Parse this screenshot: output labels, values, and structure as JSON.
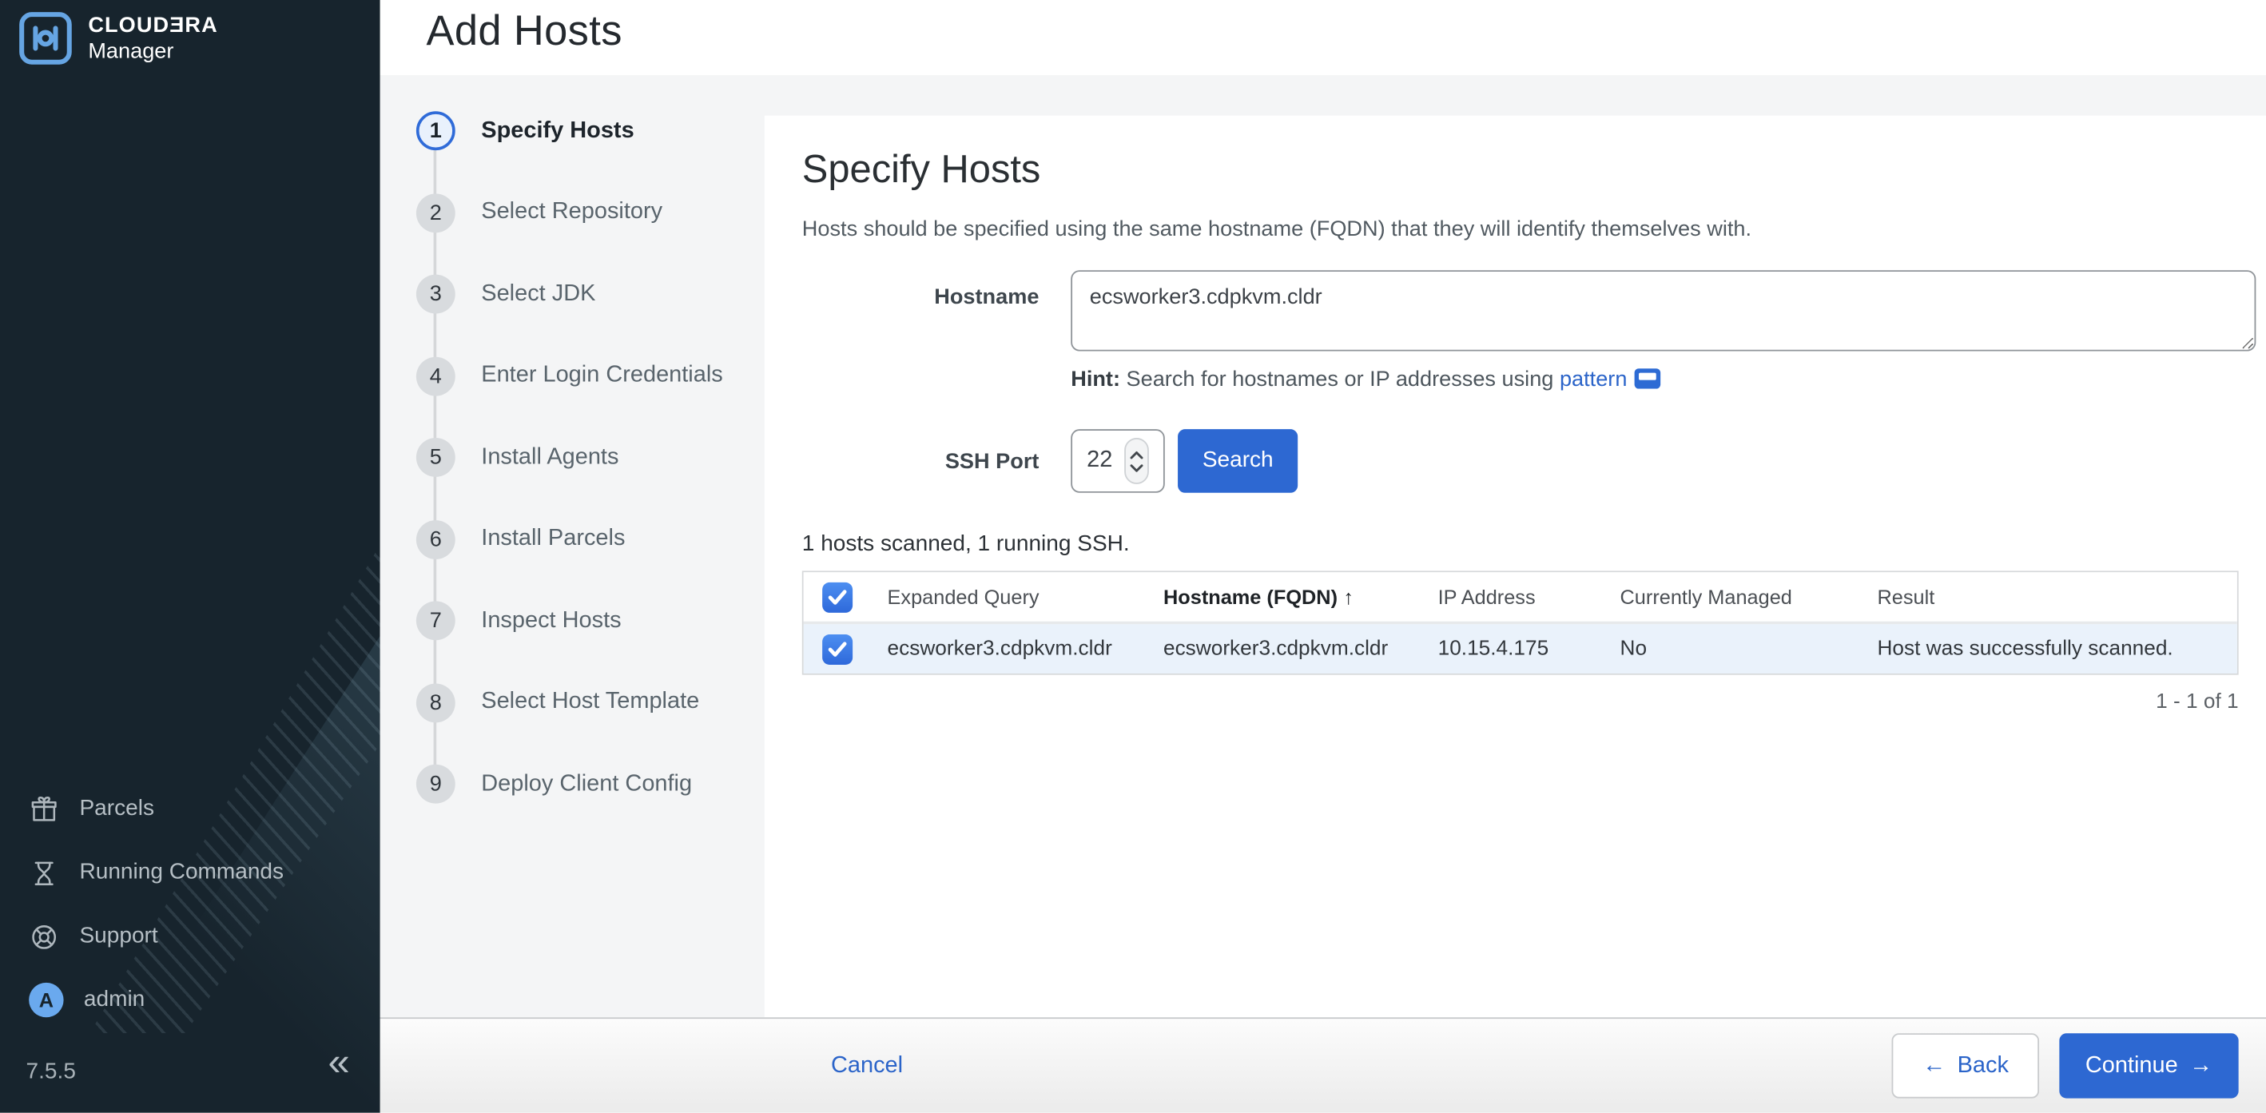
{
  "brand": {
    "name_top": "CLOUDƎRA",
    "name_bottom": "Manager"
  },
  "sidebar": {
    "items": [
      {
        "label": "Parcels",
        "icon": "gift-icon"
      },
      {
        "label": "Running Commands",
        "icon": "hourglass-icon"
      },
      {
        "label": "Support",
        "icon": "life-ring-icon"
      },
      {
        "label": "admin",
        "icon": "avatar"
      }
    ],
    "avatar_letter": "A",
    "version": "7.5.5",
    "collapse_glyph": "«"
  },
  "header": {
    "title": "Add Hosts"
  },
  "wizard": {
    "steps": [
      {
        "num": "1",
        "label": "Specify Hosts",
        "active": true
      },
      {
        "num": "2",
        "label": "Select Repository",
        "active": false
      },
      {
        "num": "3",
        "label": "Select JDK",
        "active": false
      },
      {
        "num": "4",
        "label": "Enter Login Credentials",
        "active": false
      },
      {
        "num": "5",
        "label": "Install Agents",
        "active": false
      },
      {
        "num": "6",
        "label": "Install Parcels",
        "active": false
      },
      {
        "num": "7",
        "label": "Inspect Hosts",
        "active": false
      },
      {
        "num": "8",
        "label": "Select Host Template",
        "active": false
      },
      {
        "num": "9",
        "label": "Deploy Client Config",
        "active": false
      }
    ]
  },
  "content": {
    "heading": "Specify Hosts",
    "description": "Hosts should be specified using the same hostname (FQDN) that they will identify themselves with.",
    "hostname_label": "Hostname",
    "hostname_value": "ecsworker3.cdpkvm.cldr",
    "hint_label": "Hint:",
    "hint_text": " Search for hostnames or IP addresses using ",
    "hint_link": "pattern",
    "ssh_port_label": "SSH Port",
    "ssh_port_value": "22",
    "search_button": "Search",
    "scan_status": "1 hosts scanned, 1 running SSH.",
    "table": {
      "columns": [
        "Expanded Query",
        "Hostname (FQDN)",
        "IP Address",
        "Currently Managed",
        "Result"
      ],
      "sort_column": "Hostname (FQDN)",
      "sort_arrow": "↑",
      "rows": [
        {
          "checked": true,
          "expanded_query": "ecsworker3.cdpkvm.cldr",
          "hostname": "ecsworker3.cdpkvm.cldr",
          "ip_address": "10.15.4.175",
          "currently_managed": "No",
          "result": "Host was successfully scanned."
        }
      ],
      "pagination": "1 - 1 of 1"
    }
  },
  "footer": {
    "cancel": "Cancel",
    "back_arrow": "←",
    "back": "Back",
    "continue": "Continue",
    "continue_arrow": "→"
  },
  "colors": {
    "accent_blue": "#2d68d2",
    "link_blue": "#2b64c9",
    "sidebar_bg": "#17242d",
    "selected_row_bg": "#eaf2fb",
    "wizard_bg": "#f4f5f6",
    "logo_blue": "#66a5e3",
    "avatar_blue": "#6aa9ee"
  }
}
